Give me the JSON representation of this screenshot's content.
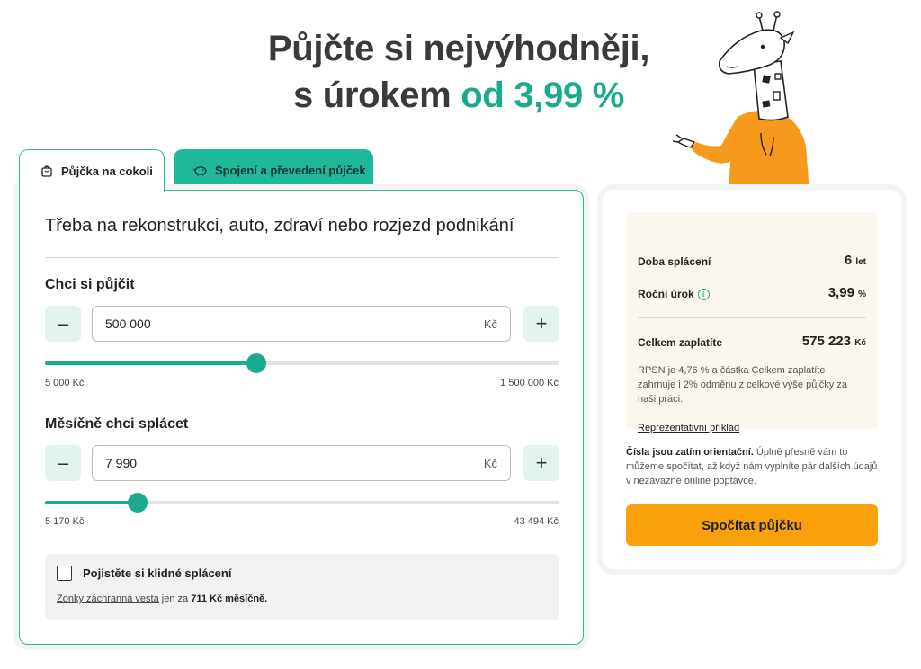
{
  "headline": {
    "line1": "Půjčte si nejvýhodněji,",
    "line2_prefix": "s úrokem",
    "line2_accent": "od 3,99 %"
  },
  "tabs": [
    {
      "label": "Půjčka na cokoli",
      "icon": "bag-icon",
      "active": true
    },
    {
      "label": "Spojení a převedení půjček",
      "icon": "piggy-bank-icon",
      "active": false
    }
  ],
  "form": {
    "title": "Třeba na rekonstrukci, auto, zdraví nebo rozjezd podnikání",
    "loan": {
      "label": "Chci si půjčit",
      "value": "500 000",
      "unit": "Kč",
      "min_label": "5 000 Kč",
      "max_label": "1 500 000 Kč",
      "slider_fraction": 0.41
    },
    "monthly": {
      "label": "Měsíčně chci splácet",
      "value": "7 990",
      "unit": "Kč",
      "min_label": "5 170 Kč",
      "max_label": "43 494 Kč",
      "slider_fraction": 0.18
    },
    "insurance": {
      "checkbox_label": "Pojistěte si klidné splácení",
      "checked": false,
      "link_text": "Zonky záchranná vesta",
      "note_middle": "jen za",
      "note_price": "711 Kč měsíčně."
    }
  },
  "summary": {
    "term_label": "Doba splácení",
    "term_value": "6",
    "term_unit": "let",
    "rate_label": "Roční úrok",
    "rate_value": "3,99",
    "rate_unit": "%",
    "total_label": "Celkem zaplatíte",
    "total_value": "575 223",
    "total_unit": "Kč",
    "rpsn_text": "RPSN je 4,76 % a částka Celkem zaplatíte zahrnuje i 2% odměnu z celkové výše půjčky za naši práci.",
    "example_link": "Reprezentativní příklad",
    "orient_bold": "Čísla jsou zatím orientační.",
    "orient_text": " Úplně přesně vám to můžeme spočítat, až když nám vyplníte pár dalších údajů v nezávazné online poptávce.",
    "cta_label": "Spočítat půjčku"
  },
  "colors": {
    "accent": "#1aab8e",
    "cta": "#f8a10d",
    "summary_box": "#fbf6ee"
  }
}
